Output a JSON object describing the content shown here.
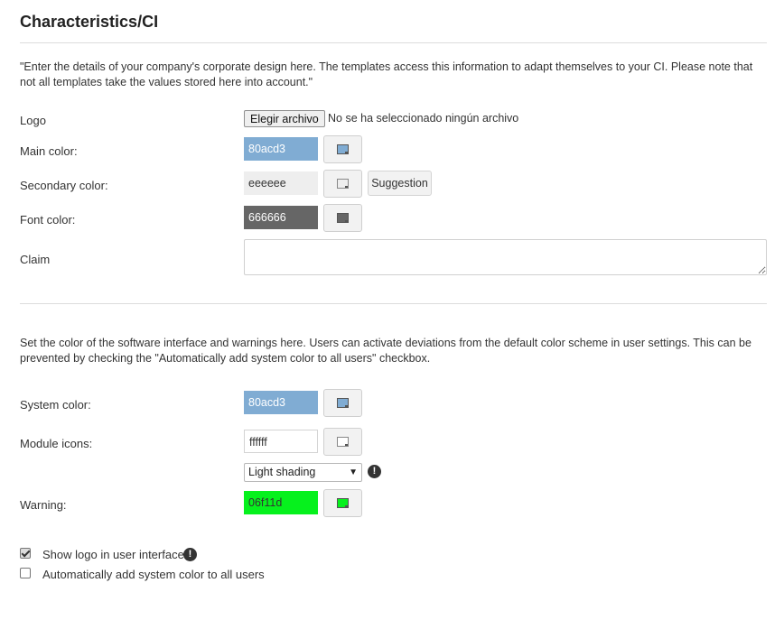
{
  "section": {
    "title": "Characteristics/CI",
    "intro": "\"Enter the details of your company's corporate design here. The templates access this information to adapt themselves to your CI. Please note that not all templates take the values stored here into account.\""
  },
  "ci": {
    "logo_label": "Logo",
    "file_button": "Elegir archivo",
    "file_status": "No se ha seleccionado ningún archivo",
    "main_color_label": "Main color:",
    "main_color_value": "80acd3",
    "main_color_hex": "#80acd3",
    "secondary_color_label": "Secondary color:",
    "secondary_color_value": "eeeeee",
    "secondary_color_hex": "#eeeeee",
    "suggestion_label": "Suggestion",
    "font_color_label": "Font color:",
    "font_color_value": "666666",
    "font_color_hex": "#666666",
    "claim_label": "Claim",
    "claim_value": ""
  },
  "system": {
    "intro": "Set the color of the software interface and warnings here. Users can activate deviations from the default color scheme in user settings. This can be prevented by checking the \"Automatically add system color to all users\" checkbox.",
    "system_color_label": "System color:",
    "system_color_value": "80acd3",
    "system_color_hex": "#80acd3",
    "module_icons_label": "Module icons:",
    "module_icons_value": "ffffff",
    "module_icons_hex": "#ffffff",
    "shading_selected": "Light shading",
    "warning_label": "Warning:",
    "warning_value": "06f11d",
    "warning_hex": "#06f11d"
  },
  "options": {
    "show_logo_label": "Show logo in user interface",
    "show_logo_checked": true,
    "auto_system_color_label": "Automatically add system color to all users",
    "auto_system_color_checked": false
  }
}
